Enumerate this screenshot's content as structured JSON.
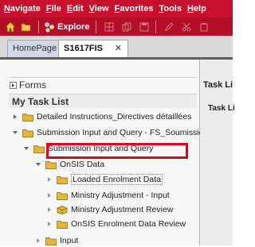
{
  "menu": [
    "Navigate",
    "File",
    "Edit",
    "View",
    "Favorites",
    "Tools",
    "Help"
  ],
  "toolbar": {
    "explore_label": "Explore"
  },
  "tabs": [
    {
      "label": "HomePage"
    },
    {
      "label": "S1617FIS",
      "close": "✕"
    }
  ],
  "left_panel": {
    "forms_label": "Forms",
    "task_list_title": "My Task List",
    "tree": [
      {
        "label": "Detailed Instructions_Directives détaillées",
        "expanded": false
      },
      {
        "label": "Submission Input and Query - FS_Soumission- En",
        "expanded": true
      },
      {
        "label": "Submission Input and Query",
        "expanded": true
      },
      {
        "label": "OnSIS Data",
        "expanded": true
      },
      {
        "label": "Loaded Enrolment Data",
        "expanded": false,
        "highlighted": true
      },
      {
        "label": "Ministry Adjustment - Input",
        "expanded": false
      },
      {
        "label": "Ministry Adjustment Review",
        "expanded": false
      },
      {
        "label": "OnSIS Enrolment Data Review",
        "expanded": false
      },
      {
        "label": "Input",
        "expanded": false
      }
    ]
  },
  "right_panel": {
    "header": "Task Li",
    "subheader": "Task Li"
  },
  "colors": {
    "menubar": "#c8102e",
    "toolbar": "#b40e28",
    "highlight": "#e2001a"
  }
}
